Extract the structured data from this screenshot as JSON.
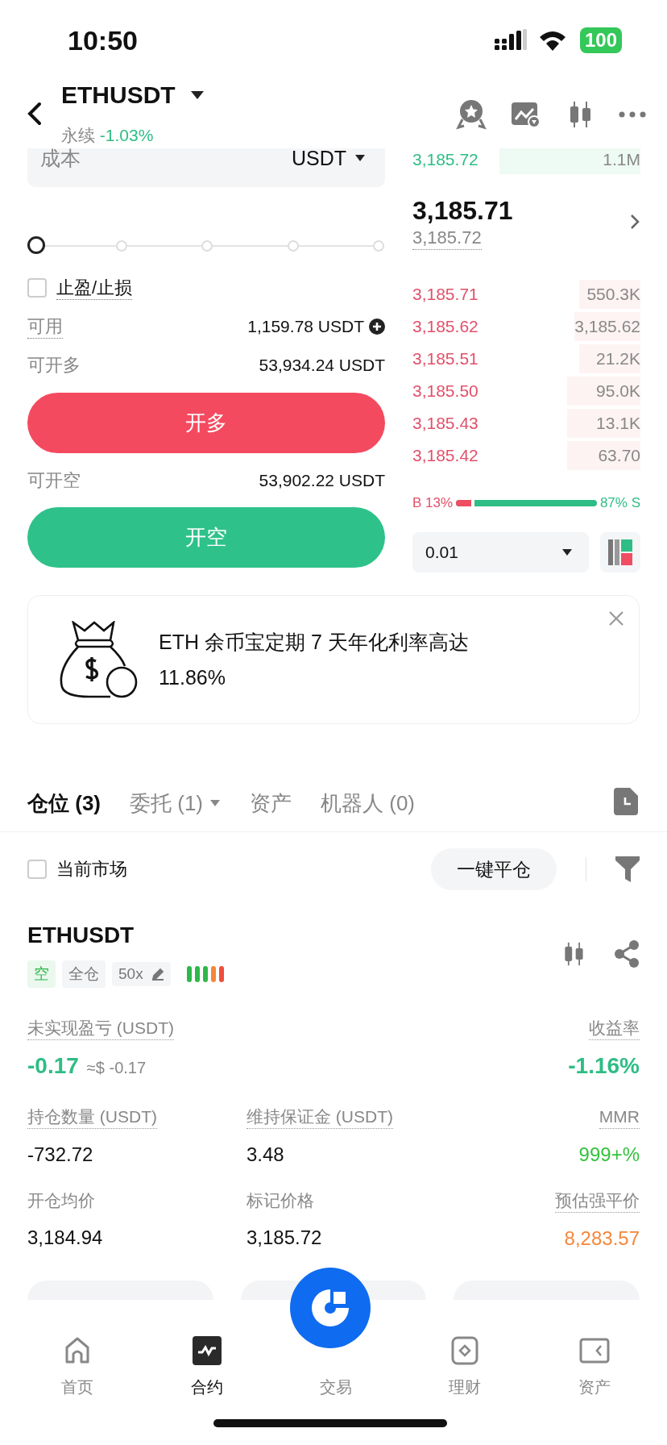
{
  "status_bar": {
    "time": "10:50",
    "battery": "100"
  },
  "header": {
    "symbol": "ETHUSDT",
    "type": "永续",
    "change": "-1.03%"
  },
  "order_form": {
    "cost_label": "成本",
    "cost_unit": "USDT",
    "slider": {
      "level": 0
    },
    "tp_sl": {
      "label": "止盈/止损",
      "checked": false
    },
    "available": {
      "label": "可用",
      "value": "1,159.78 USDT"
    },
    "long_max": {
      "label": "可开多",
      "value": "53,934.24 USDT"
    },
    "long_button": "开多",
    "short_max": {
      "label": "可开空",
      "value": "53,902.22 USDT"
    },
    "short_button": "开空"
  },
  "order_book": {
    "asks": [
      {
        "price": "3,185.72",
        "amount": "1.1M"
      }
    ],
    "last_price": "3,185.71",
    "mark_price": "3,185.72",
    "bids": [
      {
        "price": "3,185.71",
        "amount": "550.3K"
      },
      {
        "price": "3,185.62",
        "amount": "3,185.62"
      },
      {
        "price": "3,185.51",
        "amount": "21.2K"
      },
      {
        "price": "3,185.50",
        "amount": "95.0K"
      },
      {
        "price": "3,185.43",
        "amount": "13.1K"
      },
      {
        "price": "3,185.42",
        "amount": "63.70"
      }
    ],
    "ratio": {
      "buy": "B 13%",
      "sell": "87% S",
      "level": 0.13
    },
    "precision": "0.01"
  },
  "promo": {
    "text": "ETH 余币宝定期 7 天年化利率高达",
    "rate": "11.86%"
  },
  "tabs": [
    {
      "label": "仓位 (3)",
      "selected": true,
      "dropdown": false
    },
    {
      "label": "委托 (1)",
      "selected": false,
      "dropdown": true
    },
    {
      "label": "资产",
      "selected": false,
      "dropdown": false
    },
    {
      "label": "机器人 (0)",
      "selected": false,
      "dropdown": false
    }
  ],
  "filter": {
    "label": "当前市场",
    "checked": false
  },
  "close_all": "一键平仓",
  "position": {
    "symbol": "ETHUSDT",
    "tags": [
      {
        "label": "空",
        "kind": "side"
      },
      {
        "label": "全仓",
        "kind": "mode"
      },
      {
        "label": "50x",
        "kind": "leverage"
      }
    ],
    "risk_bars": [
      {
        "color": "#2fb84a"
      },
      {
        "color": "#2fb84a"
      },
      {
        "color": "#2fb84a"
      },
      {
        "color": "#f5873a"
      },
      {
        "color": "#ee4d3f"
      }
    ],
    "metrics": [
      [
        {
          "label": "未实现盈亏 (USDT)",
          "value": "-0.17",
          "note": "≈$ -0.17",
          "color": "#2ebd85",
          "tip": true
        },
        {
          "label": "收益率",
          "value": "-1.16%",
          "color": "#2ebd85",
          "tip": true
        }
      ],
      [
        {
          "label": "持仓数量 (USDT)",
          "value": "-732.72",
          "tip": true
        },
        {
          "label": "维持保证金 (USDT)",
          "value": "3.48",
          "tip": true
        },
        {
          "label": "MMR",
          "value": "999+%",
          "color": "#36c23f",
          "tip": true
        }
      ],
      [
        {
          "label": "开仓均价",
          "value": "3,184.94",
          "tip": false
        },
        {
          "label": "标记价格",
          "value": "3,185.72",
          "tip": false
        },
        {
          "label": "预估强平价",
          "value": "8,283.57",
          "color": "#f5873a",
          "tip": true
        }
      ]
    ]
  },
  "nav": [
    {
      "label": "首页",
      "kind": "home",
      "selected": false
    },
    {
      "label": "合约",
      "kind": "futures",
      "selected": true
    },
    {
      "label": "交易",
      "kind": "center",
      "selected": false
    },
    {
      "label": "理财",
      "kind": "earn",
      "selected": false
    },
    {
      "label": "资产",
      "kind": "assets",
      "selected": false
    }
  ]
}
